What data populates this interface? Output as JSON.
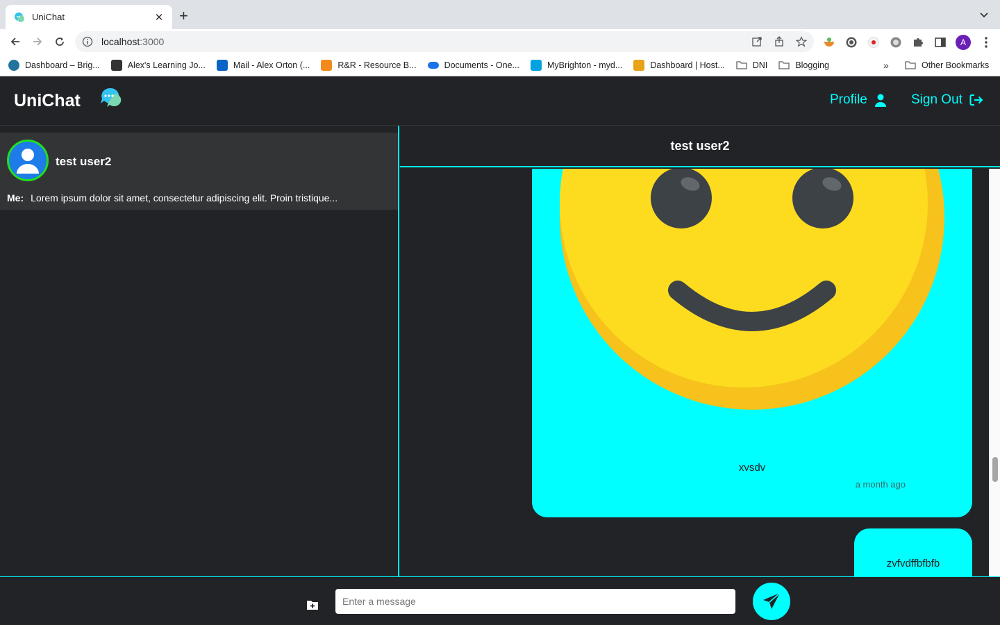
{
  "browser": {
    "tab_title": "UniChat",
    "url_host": "localhost",
    "url_port": ":3000",
    "profile_initial": "A",
    "bookmarks": [
      {
        "label": "Dashboard – Brig...",
        "icon": "wordpress-icon",
        "color": "#21759b"
      },
      {
        "label": "Alex's Learning Jo...",
        "icon": "ao-icon",
        "color": "#333333"
      },
      {
        "label": "Mail - Alex Orton (...",
        "icon": "outlook-icon",
        "color": "#0a64c8"
      },
      {
        "label": "R&R - Resource B...",
        "icon": "search-orange-icon",
        "color": "#f28b1b"
      },
      {
        "label": "Documents - One...",
        "icon": "onedrive-icon",
        "color": "#1a73e8"
      },
      {
        "label": "MyBrighton - myd...",
        "icon": "m-icon",
        "color": "#00a3e0"
      },
      {
        "label": "Dashboard | Host...",
        "icon": "host-icon",
        "color": "#e8a317"
      },
      {
        "label": "DNI",
        "icon": "folder-icon",
        "color": "#5f6368"
      },
      {
        "label": "Blogging",
        "icon": "folder-icon",
        "color": "#5f6368"
      }
    ],
    "bookmarks_more": "»",
    "other_bookmarks": "Other Bookmarks"
  },
  "app": {
    "logo": "UniChat",
    "nav": {
      "profile": "Profile",
      "sign_out": "Sign Out"
    },
    "accent_color": "#00ffff"
  },
  "sidebar": {
    "chats": [
      {
        "name": "test user2",
        "preview_prefix": "Me:",
        "preview": "Lorem ipsum dolor sit amet, consectetur adipiscing elit. Proin tristique..."
      }
    ]
  },
  "conversation": {
    "title": "test user2",
    "messages": [
      {
        "text": "xvsdv",
        "time": "a month ago",
        "attachment": "smiley-emoji-image"
      },
      {
        "text": "zvfvdffbfbfb"
      }
    ]
  },
  "composer": {
    "placeholder": "Enter a message"
  }
}
